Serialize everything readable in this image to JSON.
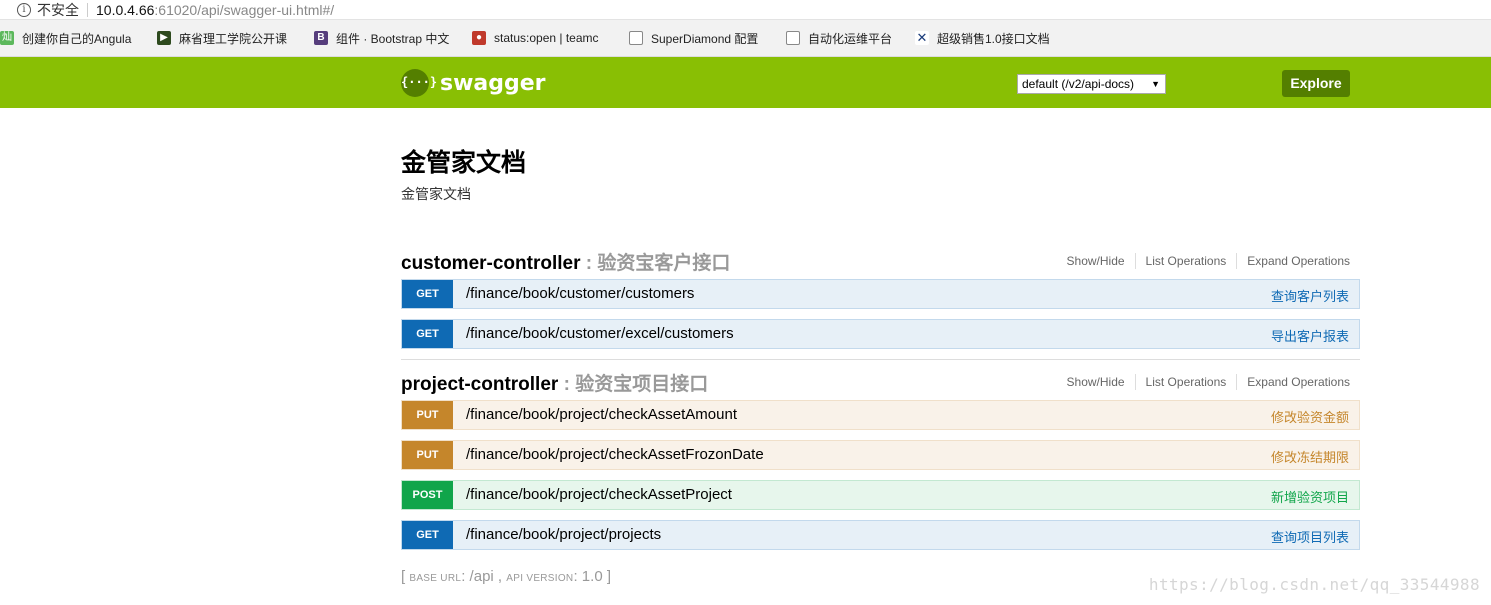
{
  "browser": {
    "security_label": "不安全",
    "url_host": "10.0.4.66",
    "url_path": ":61020/api/swagger-ui.html#/",
    "bookmarks": [
      {
        "label": "创建你自己的Angula",
        "icon": "chinese-char-icon",
        "color": "#5cb85c"
      },
      {
        "label": "麻省理工学院公开课",
        "icon": "play-icon",
        "color": "#2e4a1e"
      },
      {
        "label": "组件 · Bootstrap 中文",
        "icon": "bootstrap-icon",
        "color": "#563d7c"
      },
      {
        "label": "status:open | teamc",
        "icon": "gerrit-icon",
        "color": "#c0392b"
      },
      {
        "label": "SuperDiamond 配置",
        "icon": "page-icon",
        "color": "#888888"
      },
      {
        "label": "自动化运维平台",
        "icon": "page-icon",
        "color": "#888888"
      },
      {
        "label": "超级销售1.0接口文档",
        "icon": "x-icon",
        "color": "#1a3b7a"
      }
    ]
  },
  "header": {
    "logo_glyph": "{···}",
    "logo_text": "swagger",
    "spec_select": "default (/v2/api-docs)",
    "explore_label": "Explore"
  },
  "info": {
    "title": "金管家文档",
    "description": "金管家文档"
  },
  "resources": [
    {
      "name": "customer-controller",
      "description": " : 验资宝客户接口",
      "show_hide": "Show/Hide",
      "list_ops": "List Operations",
      "expand_ops": "Expand Operations",
      "endpoints": [
        {
          "method": "GET",
          "path": "/finance/book/customer/customers",
          "summary": "查询客户列表"
        },
        {
          "method": "GET",
          "path": "/finance/book/customer/excel/customers",
          "summary": "导出客户报表"
        }
      ]
    },
    {
      "name": "project-controller",
      "description": " : 验资宝项目接口",
      "show_hide": "Show/Hide",
      "list_ops": "List Operations",
      "expand_ops": "Expand Operations",
      "endpoints": [
        {
          "method": "PUT",
          "path": "/finance/book/project/checkAssetAmount",
          "summary": "修改验资金额"
        },
        {
          "method": "PUT",
          "path": "/finance/book/project/checkAssetFrozonDate",
          "summary": "修改冻结期限"
        },
        {
          "method": "POST",
          "path": "/finance/book/project/checkAssetProject",
          "summary": "新增验资项目"
        },
        {
          "method": "GET",
          "path": "/finance/book/project/projects",
          "summary": "查询项目列表"
        }
      ]
    }
  ],
  "footer": {
    "open_bracket": "[",
    "base_url_label": "BASE URL",
    "base_url": ": /api , ",
    "api_version_label": "API VERSION",
    "api_version": ": 1.0 ",
    "close_bracket": "]"
  },
  "watermark": "https://blog.csdn.net/qq_33544988",
  "colors": {
    "header_bg": "#89bf04",
    "get": "#0f6ab4",
    "put": "#c5862b",
    "post": "#10a54a"
  }
}
